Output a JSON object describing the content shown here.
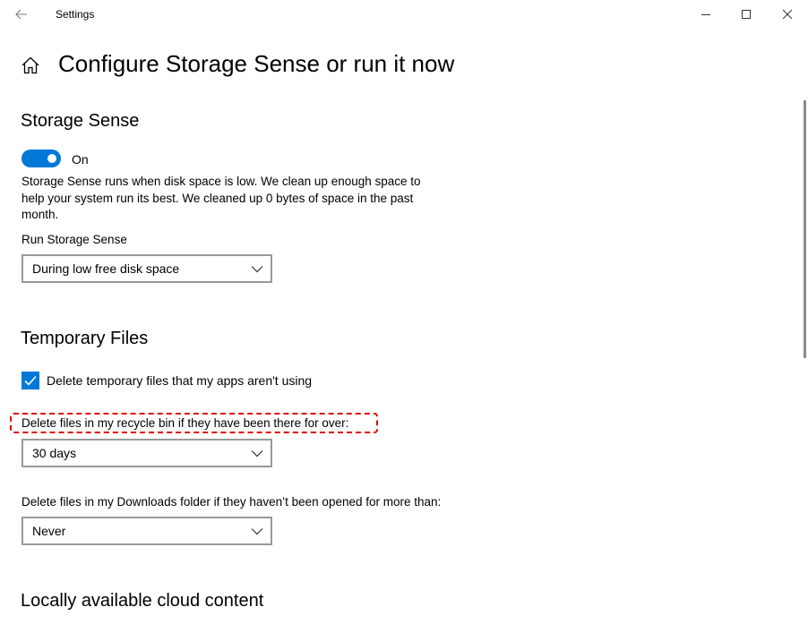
{
  "window": {
    "title": "Settings"
  },
  "page": {
    "title": "Configure Storage Sense or run it now"
  },
  "storage_sense": {
    "heading": "Storage Sense",
    "toggle": {
      "state_label": "On",
      "on": true
    },
    "description": "Storage Sense runs when disk space is low. We clean up enough space to help your system run its best. We cleaned up 0 bytes of space in the past month.",
    "run_label": "Run Storage Sense",
    "run_selected": "During low free disk space"
  },
  "temporary_files": {
    "heading": "Temporary Files",
    "delete_temp_label": "Delete temporary files that my apps aren't using",
    "delete_temp_checked": true,
    "recycle_bin_label": "Delete files in my recycle bin if they have been there for over:",
    "recycle_bin_selected": "30 days",
    "downloads_label": "Delete files in my Downloads folder if they haven’t been opened for more than:",
    "downloads_selected": "Never"
  },
  "cloud": {
    "heading": "Locally available cloud content"
  },
  "colors": {
    "accent": "#0078d7",
    "highlight": "#e00000"
  }
}
